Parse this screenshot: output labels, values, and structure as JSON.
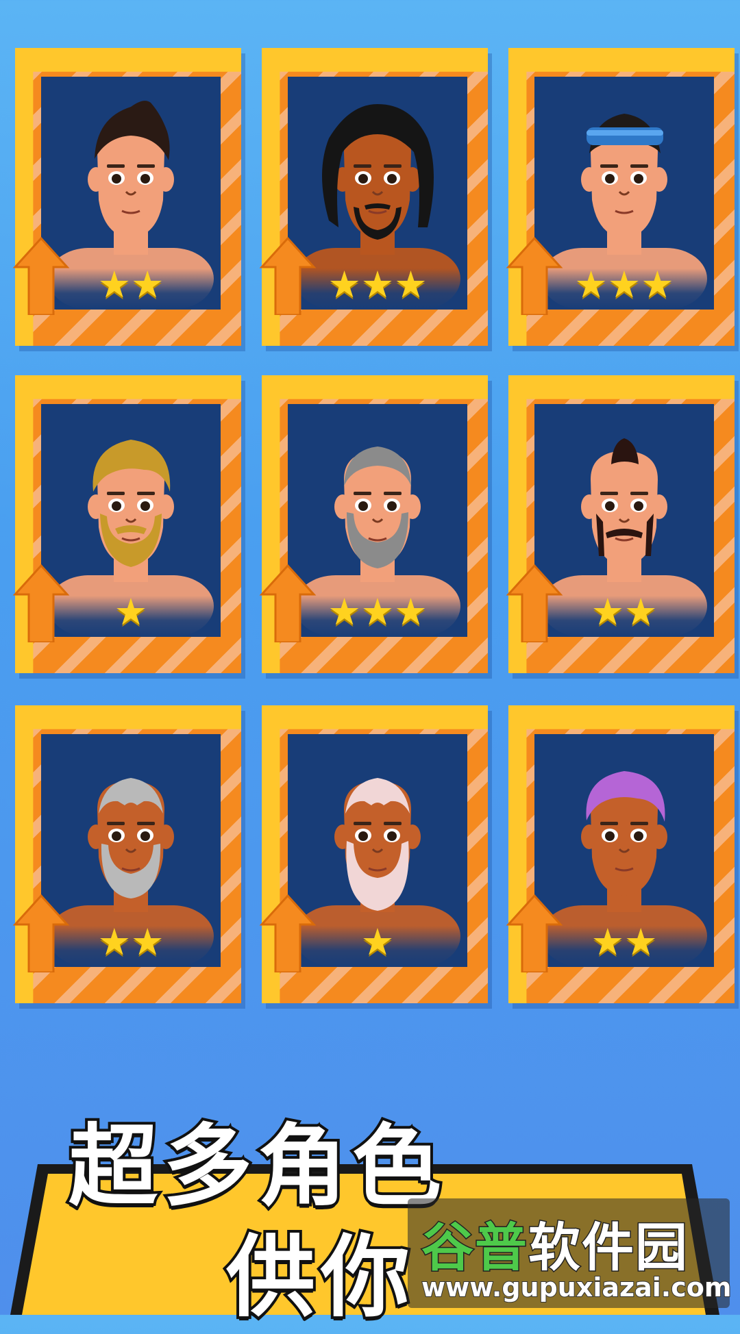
{
  "characters": [
    {
      "stars": "★★",
      "star_count": 2,
      "skin": "#f2a07a",
      "hair": "#2a1a14",
      "style": "spiky"
    },
    {
      "stars": "★★★",
      "star_count": 3,
      "skin": "#b9561f",
      "hair": "#151515",
      "style": "dreads"
    },
    {
      "stars": "★★★",
      "star_count": 3,
      "skin": "#f2a07a",
      "hair": "#1f1a18",
      "style": "headband"
    },
    {
      "stars": "★",
      "star_count": 1,
      "skin": "#f2a07a",
      "hair": "#c89a2a",
      "style": "blond-beard"
    },
    {
      "stars": "★★★",
      "star_count": 3,
      "skin": "#f2a07a",
      "hair": "#8b8b8b",
      "style": "grey-beard"
    },
    {
      "stars": "★★",
      "star_count": 2,
      "skin": "#f2a07a",
      "hair": "#2a1410",
      "style": "mohawk"
    },
    {
      "stars": "★★",
      "star_count": 2,
      "skin": "#c4602a",
      "hair": "#b9b9b9",
      "style": "old-grey"
    },
    {
      "stars": "★",
      "star_count": 1,
      "skin": "#c4602a",
      "hair": "#f1d6d6",
      "style": "old-white"
    },
    {
      "stars": "★★",
      "star_count": 2,
      "skin": "#c4602a",
      "hair": "#b565d6",
      "style": "purple"
    }
  ],
  "banner": {
    "line1": "超多角色",
    "line2": "供你",
    "color": "#ffc72c"
  },
  "watermark": {
    "brand_green": "谷普",
    "brand_white": "软件园",
    "url": "www.gupuxiazai.com"
  }
}
